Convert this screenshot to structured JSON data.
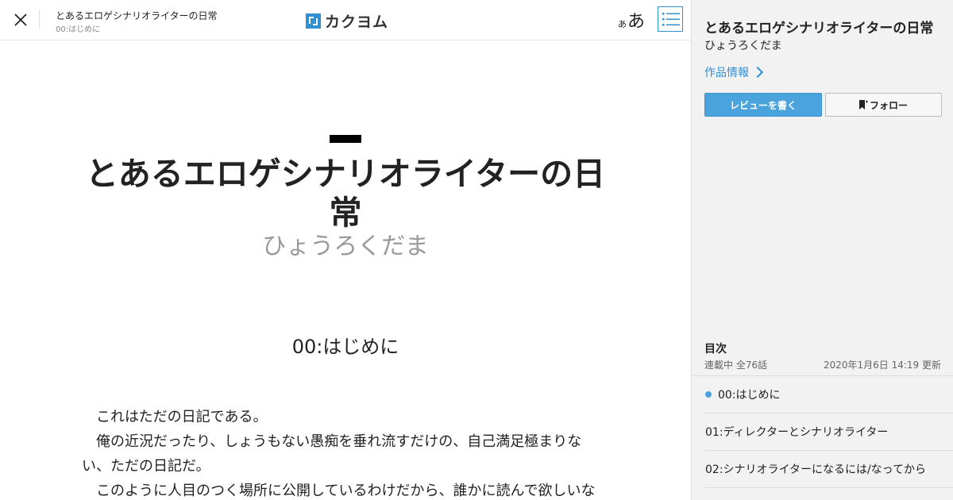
{
  "header": {
    "work_title": "とあるエロゲシナリオライターの日常",
    "episode_title": "00:はじめに",
    "logo_text": "カクヨム",
    "font_size_small": "あ",
    "font_size_big": "あ"
  },
  "main": {
    "title": "とあるエロゲシナリオライターの日常",
    "author": "ひょうろくだま",
    "episode_title": "00:はじめに",
    "paragraphs": [
      "　これはただの日記である。",
      "　俺の近況だったり、しょうもない愚痴を垂れ流すだけの、自己満足極まりない、ただの日記だ。",
      "　このように人目のつく場所に公開しているわけだから、誰かに読んで欲しいな"
    ]
  },
  "sidebar": {
    "title": "とあるエロゲシナリオライターの日常",
    "author": "ひょうろくだま",
    "info_link": "作品情報",
    "review_button": "レビューを書く",
    "follow_button": "フォロー",
    "toc_heading": "目次",
    "toc_status": "連載中 全76話",
    "toc_updated": "2020年1月6日 14:19 更新",
    "episodes": [
      {
        "label": "00:はじめに",
        "current": true
      },
      {
        "label": "01:ディレクターとシナリオライター",
        "current": false
      },
      {
        "label": "02:シナリオライターになるには/なってから",
        "current": false
      }
    ]
  },
  "colors": {
    "accent": "#2f8fd1",
    "review_button_bg": "#4aa3dc",
    "sidebar_bg": "#f2f2f2"
  },
  "icons": [
    "close-icon",
    "toc-list-icon",
    "bookmark-icon",
    "chevron-right-icon"
  ]
}
